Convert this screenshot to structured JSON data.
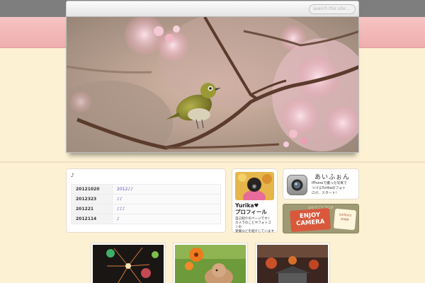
{
  "header": {
    "search_placeholder": "search this site..."
  },
  "entries": {
    "title": "♪",
    "rows": [
      {
        "date": "20121020",
        "text": "2012♪♪"
      },
      {
        "date": "2012323",
        "text": "♪♪"
      },
      {
        "date": "201221",
        "text": "♪♪♪"
      },
      {
        "date": "2012114",
        "text": "♪"
      }
    ]
  },
  "profile": {
    "name_line1": "Yurika♥",
    "name_line2": "プロフィール",
    "desc_line1": "自己紹介のページです♪",
    "desc_line2": "カメラのことやフォトコンの",
    "desc_line3": "受賞などを紹介しています"
  },
  "iphone": {
    "title": "あいふぉん",
    "desc_line1": "iPhoneで撮った写真で",
    "desc_line2": "つづるYurikaのフォト",
    "desc_line3": "ログ、スタート！"
  },
  "enjoy": {
    "top_text": "ひとりごとブログ",
    "main_line1": "ENJOY",
    "main_line2": "CAMERA",
    "badge_line1": "yurika's",
    "badge_line2": "page"
  },
  "colors": {
    "background": "#fdf1d4",
    "pink_band": "#f6c4c3",
    "top_band": "#7e7e7e",
    "link": "#5b54b0"
  }
}
